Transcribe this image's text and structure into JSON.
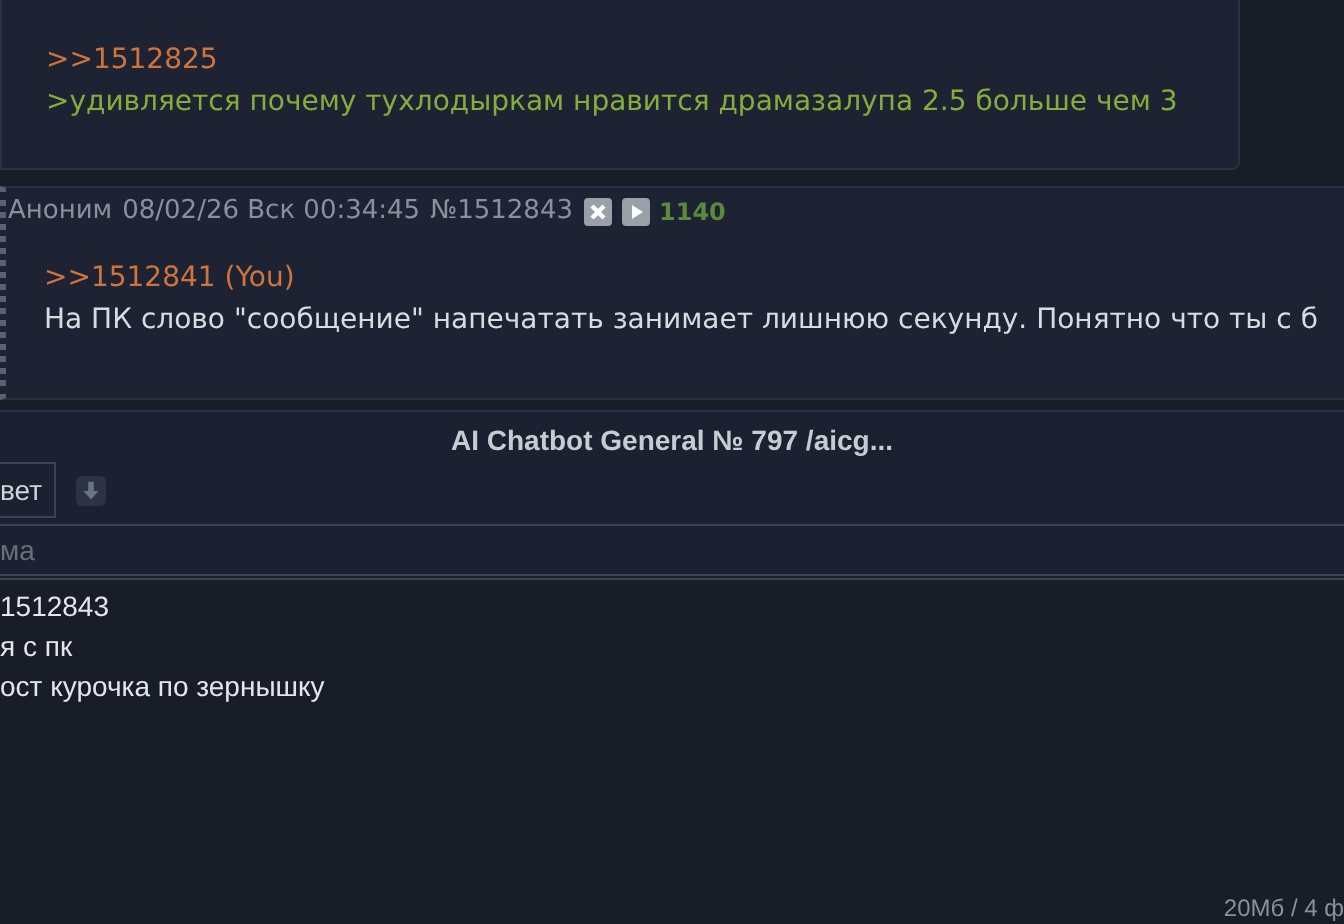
{
  "posts": [
    {
      "reply_link": ">>1512825",
      "lines": [
        {
          "kind": "quote",
          "text": ">удивляется почему тухлодыркам нравится драмазалупа 2.5 больше чем 3"
        }
      ]
    },
    {
      "header": {
        "author": "Аноним",
        "date": "08/02/26 Вск 00:34:45",
        "number": "№1512843",
        "count": "1140"
      },
      "reply_link": ">>1512841 (You)",
      "lines": [
        {
          "kind": "text",
          "text": "На ПК слово \"сообщение\" напечатать занимает лишнюю секунду. Понятно что ты с б"
        }
      ]
    }
  ],
  "reply_form": {
    "title": "AI Chatbot General № 797 /aicg...",
    "reply_button": "вет",
    "subject_placeholder": "ма",
    "message_lines": [
      "1512843",
      "я с пк",
      "ост курочка по зернышку"
    ],
    "limits": "20Мб / 4 ф"
  }
}
